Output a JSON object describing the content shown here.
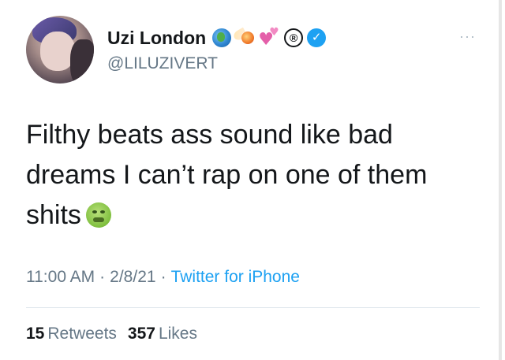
{
  "author": {
    "display_name": "Uzi London",
    "handle": "@LILUZIVERT",
    "verified": true,
    "name_emojis": [
      "globe-icon",
      "comet-icon",
      "hearts-icon",
      "registered-icon"
    ],
    "registered_symbol": "®",
    "verified_symbol": "✓"
  },
  "menu": {
    "more_symbol": "···"
  },
  "tweet": {
    "text": "Filthy beats ass sound like bad dreams I can’t rap on one of them shits",
    "trailing_emoji": "nauseated-face-icon"
  },
  "meta": {
    "time": "11:00 AM",
    "separator": "·",
    "date": "2/8/21",
    "source": "Twitter for iPhone"
  },
  "stats": {
    "retweets_count": "15",
    "retweets_label": "Retweets",
    "likes_count": "357",
    "likes_label": "Likes"
  },
  "colors": {
    "text": "#14171a",
    "secondary": "#657786",
    "link": "#1da1f2",
    "divider": "#e1e8ed",
    "verified_badge": "#1da1f2"
  }
}
